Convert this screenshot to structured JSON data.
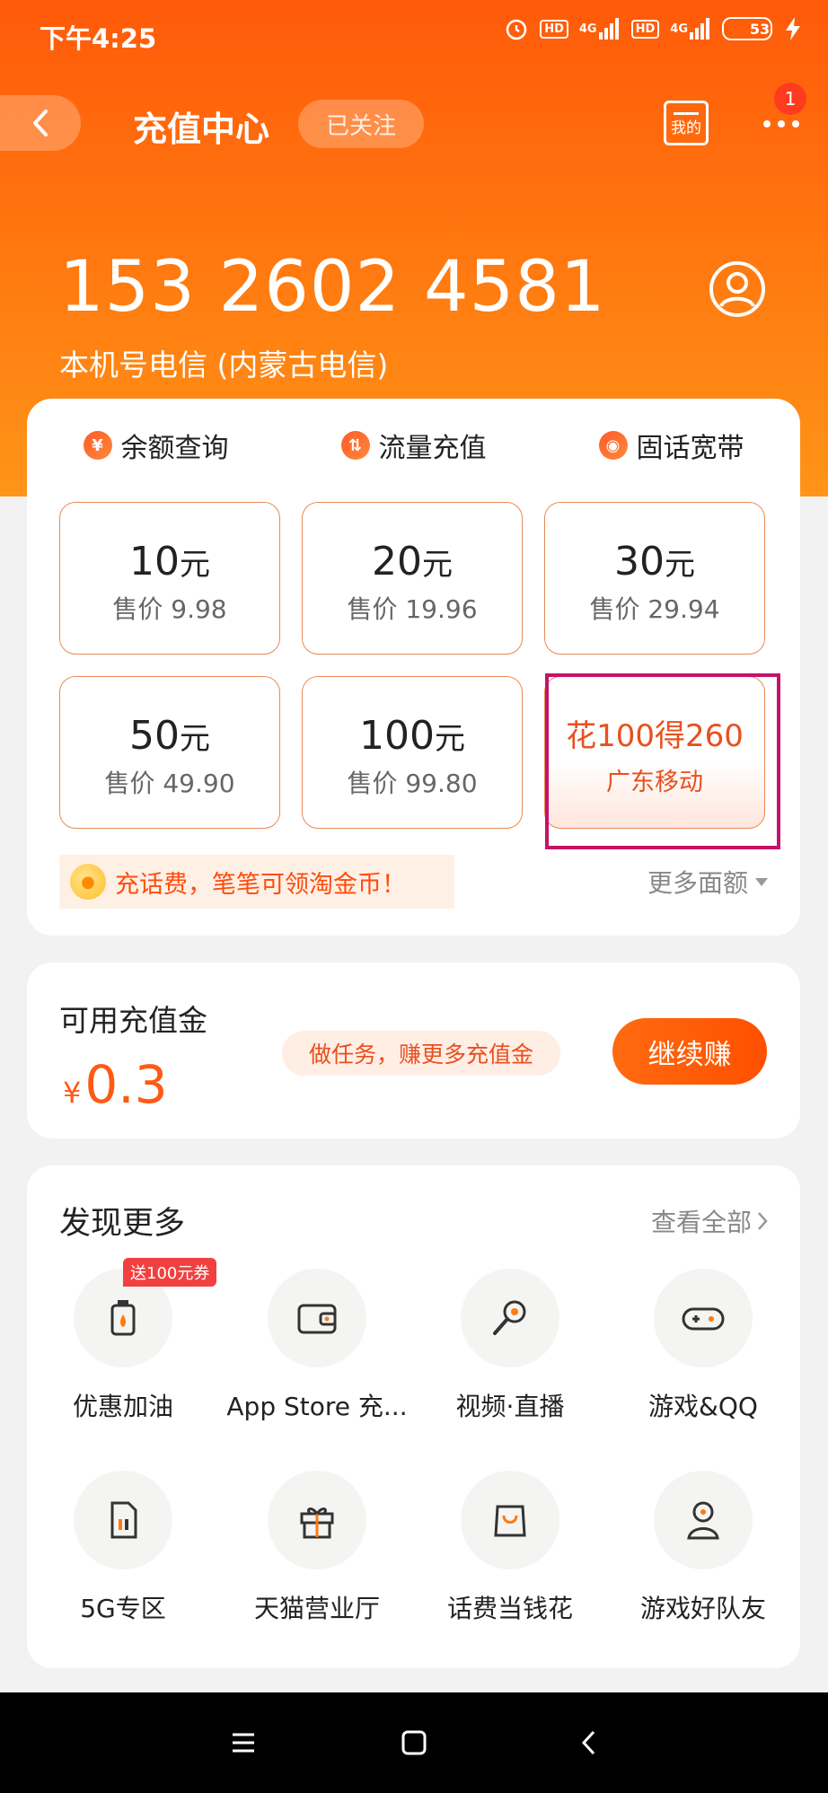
{
  "status_bar": {
    "time": "下午4:25",
    "hd1": "HD",
    "net1": "4G",
    "hd2": "HD",
    "net2": "4G",
    "battery": "53"
  },
  "nav": {
    "title": "充值中心",
    "follow_label": "已关注",
    "my_label": "我的",
    "notification_count": "1"
  },
  "account": {
    "phone_number": "153 2602 4581",
    "carrier": "本机号电信 (内蒙古电信)"
  },
  "quick_tabs": [
    {
      "label": "余额查询",
      "icon": "yen-icon",
      "glyph": "¥"
    },
    {
      "label": "流量充值",
      "icon": "data-icon",
      "glyph": "⇅"
    },
    {
      "label": "固话宽带",
      "icon": "wifi-icon",
      "glyph": "◉"
    }
  ],
  "amounts": [
    {
      "amount": "10",
      "unit": "元",
      "price": "售价 9.98"
    },
    {
      "amount": "20",
      "unit": "元",
      "price": "售价 19.96"
    },
    {
      "amount": "30",
      "unit": "元",
      "price": "售价 29.94"
    },
    {
      "amount": "50",
      "unit": "元",
      "price": "售价 49.90"
    },
    {
      "amount": "100",
      "unit": "元",
      "price": "售价 99.80"
    }
  ],
  "promo": {
    "title": "花100得260",
    "subtitle": "广东移动"
  },
  "coin_banner": "充话费，笔笔可领淘金币！",
  "more_amounts": "更多面额",
  "balance": {
    "label": "可用充值金",
    "currency": "¥",
    "value": "0.3",
    "task_text": "做任务，赚更多充值金",
    "earn_button": "继续赚"
  },
  "discover": {
    "title": "发现更多",
    "view_all": "查看全部",
    "items": [
      {
        "label": "优惠加油",
        "icon": "fuel-icon",
        "tag": "送100元券"
      },
      {
        "label": "App Store 充...",
        "icon": "wallet-icon"
      },
      {
        "label": "视频·直播",
        "icon": "microphone-icon"
      },
      {
        "label": "游戏&QQ",
        "icon": "gamepad-icon"
      },
      {
        "label": "5G专区",
        "icon": "sim-card-icon"
      },
      {
        "label": "天猫营业厅",
        "icon": "gift-icon"
      },
      {
        "label": "话费当钱花",
        "icon": "shopping-bag-icon"
      },
      {
        "label": "游戏好队友",
        "icon": "person-icon"
      }
    ]
  },
  "colors": {
    "accent": "#ff5a14",
    "header_top": "#ff5a0a",
    "header_bottom": "#ff9418",
    "highlight_border": "#c4136a"
  }
}
